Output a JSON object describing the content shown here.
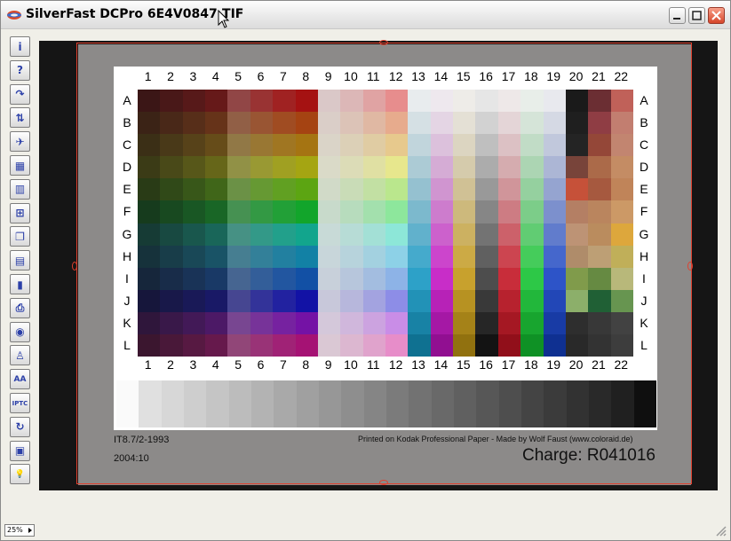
{
  "window": {
    "title": "SilverFast DCPro 6E4V0847.TIF",
    "controls": [
      "minimize",
      "maximize",
      "close"
    ]
  },
  "toolbar": {
    "items": [
      {
        "name": "info",
        "glyph": "i"
      },
      {
        "name": "help",
        "glyph": "?"
      },
      {
        "name": "rotate",
        "glyph": "↷"
      },
      {
        "name": "flip",
        "glyph": "⇅"
      },
      {
        "name": "pilot",
        "glyph": "✈"
      },
      {
        "name": "color-grid",
        "glyph": "▦"
      },
      {
        "name": "histogram",
        "glyph": "▥"
      },
      {
        "name": "add-frame",
        "glyph": "⊞"
      },
      {
        "name": "copy-frames",
        "glyph": "❐"
      },
      {
        "name": "gradation",
        "glyph": "▤"
      },
      {
        "name": "densitometer",
        "glyph": "▮"
      },
      {
        "name": "print",
        "glyph": "⎙"
      },
      {
        "name": "preview-eye",
        "glyph": "◉"
      },
      {
        "name": "joystick",
        "glyph": "♙"
      },
      {
        "name": "aa-cc",
        "glyph": "AA"
      },
      {
        "name": "iptc",
        "glyph": "IPTC"
      },
      {
        "name": "refresh",
        "glyph": "↻"
      },
      {
        "name": "job-manager",
        "glyph": "▣"
      },
      {
        "name": "tips",
        "glyph": "💡"
      }
    ]
  },
  "target": {
    "columns": [
      "1",
      "2",
      "3",
      "4",
      "5",
      "6",
      "7",
      "8",
      "9",
      "10",
      "11",
      "12",
      "13",
      "14",
      "15",
      "16",
      "17",
      "18",
      "19",
      "20",
      "21",
      "22"
    ],
    "rows": [
      "A",
      "B",
      "C",
      "D",
      "E",
      "F",
      "G",
      "H",
      "I",
      "J",
      "K",
      "L"
    ],
    "standard": "IT8.7/2-1993",
    "date": "2004:10",
    "printed_on": "Printed on Kodak Professional Paper  -  Made by Wolf Faust (www.coloraid.de)",
    "charge": "Charge: R041016"
  },
  "status": {
    "zoom": "25%"
  },
  "colors": {
    "crop_frame": "#e0402e",
    "viewport_bg": "#151515",
    "board": "#8c8a89"
  }
}
